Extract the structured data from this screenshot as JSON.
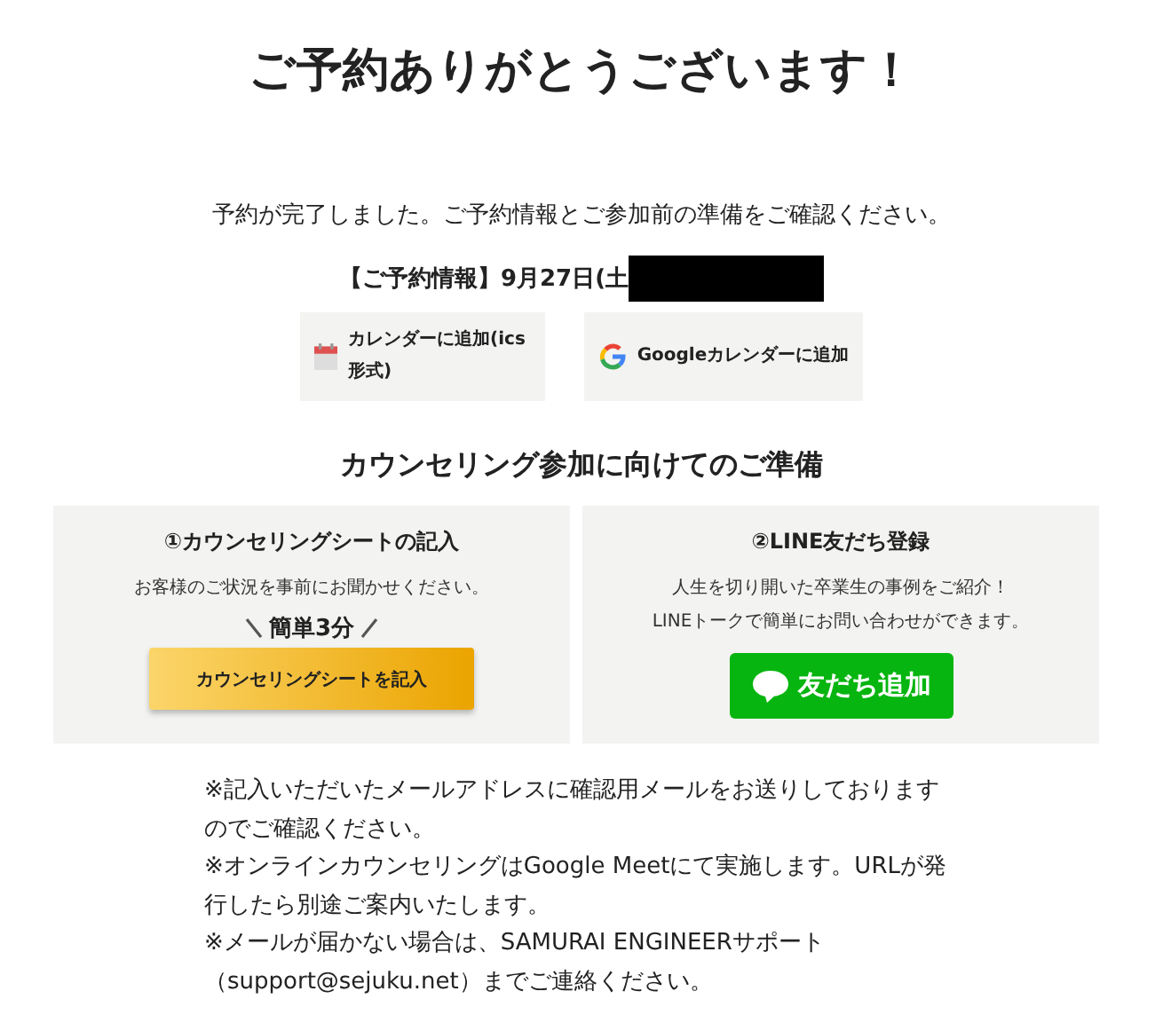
{
  "title": "ご予約ありがとうございます！",
  "message": "予約が完了しました。ご予約情報とご参加前の準備をご確認ください。",
  "reservation": {
    "label": "【ご予約情報】9月27日(土",
    "redacted": true
  },
  "calendar_buttons": [
    {
      "kind": "ics",
      "label": "カレンダーに追加(ics形式)"
    },
    {
      "kind": "google",
      "label": "Googleカレンダーに追加"
    }
  ],
  "section_title": "カウンセリング参加に向けてのご準備",
  "cards": [
    {
      "kind": "sheet",
      "title": "①カウンセリングシートの記入",
      "lines": [
        "お客様のご状況を事前にお聞かせください。"
      ],
      "badge": "簡単3分",
      "button": "カウンセリングシートを記入"
    },
    {
      "kind": "line",
      "title": "②LINE友だち登録",
      "lines": [
        "人生を切り開いた卒業生の事例をご紹介！",
        "LINEトークで簡単にお問い合わせができます。"
      ],
      "button": "友だち追加"
    }
  ],
  "notes": [
    "※記入いただいたメールアドレスに確認用メールをお送りしておりますのでご確認ください。",
    "※オンラインカウンセリングはGoogle Meetにて実施します。URLが発行したら別途ご案内いたします。",
    "※メールが届かない場合は、SAMURAI ENGINEERサポート（support@sejuku.net）までご連絡ください。"
  ]
}
